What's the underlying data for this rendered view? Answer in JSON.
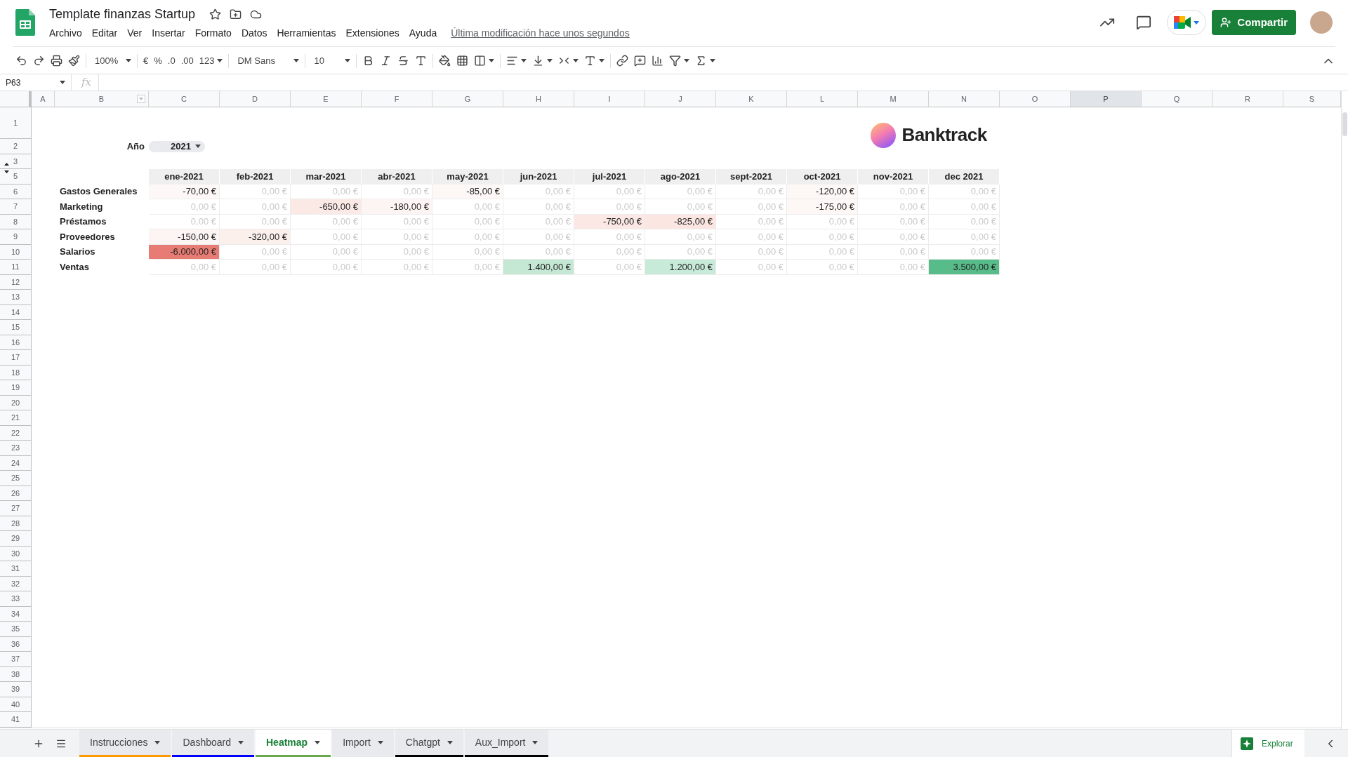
{
  "app": {
    "title": "Template finanzas Startup",
    "menu": [
      "Archivo",
      "Editar",
      "Ver",
      "Insertar",
      "Formato",
      "Datos",
      "Herramientas",
      "Extensiones",
      "Ayuda"
    ],
    "last_edit": "Última modificación hace unos segundos",
    "share_button": "Compartir"
  },
  "toolbar": {
    "zoom": "100%",
    "currency": "€",
    "percent": "%",
    "decrease_decimals": ".0",
    "increase_decimals": ".00",
    "more_formats": "123",
    "font": "DM Sans",
    "font_size": "10"
  },
  "formula_bar": {
    "cell_ref": "P63",
    "fx": "fx"
  },
  "grid": {
    "columns": [
      {
        "label": "A",
        "selected": false
      },
      {
        "label": "B",
        "selected": false
      },
      {
        "label": "C",
        "selected": false
      },
      {
        "label": "D",
        "selected": false
      },
      {
        "label": "E",
        "selected": false
      },
      {
        "label": "F",
        "selected": false
      },
      {
        "label": "G",
        "selected": false
      },
      {
        "label": "H",
        "selected": false
      },
      {
        "label": "I",
        "selected": false
      },
      {
        "label": "J",
        "selected": false
      },
      {
        "label": "K",
        "selected": false
      },
      {
        "label": "L",
        "selected": false
      },
      {
        "label": "M",
        "selected": false
      },
      {
        "label": "N",
        "selected": false
      },
      {
        "label": "O",
        "selected": false
      },
      {
        "label": "P",
        "selected": true
      },
      {
        "label": "Q",
        "selected": false
      },
      {
        "label": "R",
        "selected": false
      },
      {
        "label": "S",
        "selected": false
      }
    ],
    "rows": [
      "1",
      "2",
      "3",
      "5",
      "6",
      "7",
      "8",
      "9",
      "10",
      "11",
      "12",
      "13",
      "14",
      "15",
      "16",
      "17",
      "18",
      "19",
      "20",
      "21",
      "22",
      "23",
      "24",
      "25",
      "26",
      "27",
      "28",
      "29",
      "30",
      "31",
      "32",
      "33",
      "34",
      "35",
      "36",
      "37",
      "38",
      "39",
      "40",
      "41"
    ]
  },
  "year_selector": {
    "label": "Año",
    "value": "2021"
  },
  "logo": {
    "text": "Banktrack"
  },
  "heatmap": {
    "months": [
      "ene-2021",
      "feb-2021",
      "mar-2021",
      "abr-2021",
      "may-2021",
      "jun-2021",
      "jul-2021",
      "ago-2021",
      "sept-2021",
      "oct-2021",
      "nov-2021",
      "dec 2021"
    ],
    "rows": [
      {
        "label": "Gastos Generales",
        "cells": [
          {
            "value": "-70,00 €",
            "muted": false,
            "color": "#fdf8f7"
          },
          {
            "value": "0,00 €",
            "muted": true
          },
          {
            "value": "0,00 €",
            "muted": true
          },
          {
            "value": "0,00 €",
            "muted": true
          },
          {
            "value": "-85,00 €",
            "muted": false,
            "color": "#fdf8f6"
          },
          {
            "value": "0,00 €",
            "muted": true
          },
          {
            "value": "0,00 €",
            "muted": true
          },
          {
            "value": "0,00 €",
            "muted": true
          },
          {
            "value": "0,00 €",
            "muted": true
          },
          {
            "value": "-120,00 €",
            "muted": false,
            "color": "#fdf8f6"
          },
          {
            "value": "0,00 €",
            "muted": true
          },
          {
            "value": "0,00 €",
            "muted": true
          }
        ]
      },
      {
        "label": "Marketing",
        "cells": [
          {
            "value": "0,00 €",
            "muted": true
          },
          {
            "value": "0,00 €",
            "muted": true
          },
          {
            "value": "-650,00 €",
            "muted": false,
            "color": "#fbe9e6"
          },
          {
            "value": "-180,00 €",
            "muted": false,
            "color": "#fdf5f3"
          },
          {
            "value": "0,00 €",
            "muted": true
          },
          {
            "value": "0,00 €",
            "muted": true
          },
          {
            "value": "0,00 €",
            "muted": true
          },
          {
            "value": "0,00 €",
            "muted": true
          },
          {
            "value": "0,00 €",
            "muted": true
          },
          {
            "value": "-175,00 €",
            "muted": false,
            "color": "#fdf7f5"
          },
          {
            "value": "0,00 €",
            "muted": true
          },
          {
            "value": "0,00 €",
            "muted": true
          }
        ]
      },
      {
        "label": "Préstamos",
        "cells": [
          {
            "value": "0,00 €",
            "muted": true
          },
          {
            "value": "0,00 €",
            "muted": true
          },
          {
            "value": "0,00 €",
            "muted": true
          },
          {
            "value": "0,00 €",
            "muted": true
          },
          {
            "value": "0,00 €",
            "muted": true
          },
          {
            "value": "0,00 €",
            "muted": true
          },
          {
            "value": "-750,00 €",
            "muted": false,
            "color": "#fbe8e4"
          },
          {
            "value": "-825,00 €",
            "muted": false,
            "color": "#fbe6e2"
          },
          {
            "value": "0,00 €",
            "muted": true
          },
          {
            "value": "0,00 €",
            "muted": true
          },
          {
            "value": "0,00 €",
            "muted": true
          },
          {
            "value": "0,00 €",
            "muted": true
          }
        ]
      },
      {
        "label": "Proveedores",
        "cells": [
          {
            "value": "-150,00 €",
            "muted": false,
            "color": "#fdf5f3"
          },
          {
            "value": "-320,00 €",
            "muted": false,
            "color": "#fcf0ed"
          },
          {
            "value": "0,00 €",
            "muted": true
          },
          {
            "value": "0,00 €",
            "muted": true
          },
          {
            "value": "0,00 €",
            "muted": true
          },
          {
            "value": "0,00 €",
            "muted": true
          },
          {
            "value": "0,00 €",
            "muted": true
          },
          {
            "value": "0,00 €",
            "muted": true
          },
          {
            "value": "0,00 €",
            "muted": true
          },
          {
            "value": "0,00 €",
            "muted": true
          },
          {
            "value": "0,00 €",
            "muted": true
          },
          {
            "value": "0,00 €",
            "muted": true
          }
        ]
      },
      {
        "label": "Salarios",
        "cells": [
          {
            "value": "-6.000,00 €",
            "muted": false,
            "color": "#e67c73"
          },
          {
            "value": "0,00 €",
            "muted": true
          },
          {
            "value": "0,00 €",
            "muted": true
          },
          {
            "value": "0,00 €",
            "muted": true
          },
          {
            "value": "0,00 €",
            "muted": true
          },
          {
            "value": "0,00 €",
            "muted": true
          },
          {
            "value": "0,00 €",
            "muted": true
          },
          {
            "value": "0,00 €",
            "muted": true
          },
          {
            "value": "0,00 €",
            "muted": true
          },
          {
            "value": "0,00 €",
            "muted": true
          },
          {
            "value": "0,00 €",
            "muted": true
          },
          {
            "value": "0,00 €",
            "muted": true
          }
        ]
      },
      {
        "label": "Ventas",
        "cells": [
          {
            "value": "0,00 €",
            "muted": true
          },
          {
            "value": "0,00 €",
            "muted": true
          },
          {
            "value": "0,00 €",
            "muted": true
          },
          {
            "value": "0,00 €",
            "muted": true
          },
          {
            "value": "0,00 €",
            "muted": true
          },
          {
            "value": "1.400,00 €",
            "muted": false,
            "color": "#c5e8d4"
          },
          {
            "value": "0,00 €",
            "muted": true
          },
          {
            "value": "1.200,00 €",
            "muted": false,
            "color": "#c8eAd8"
          },
          {
            "value": "0,00 €",
            "muted": true
          },
          {
            "value": "0,00 €",
            "muted": true
          },
          {
            "value": "0,00 €",
            "muted": true
          },
          {
            "value": "3.500,00 €",
            "muted": false,
            "color": "#57bb8a"
          }
        ]
      }
    ]
  },
  "sheet_tabs": [
    {
      "label": "Instrucciones",
      "selected": false,
      "color": "#ff9900"
    },
    {
      "label": "Dashboard",
      "selected": false,
      "color": "#0000ff"
    },
    {
      "label": "Heatmap",
      "selected": true,
      "color": "#6aa84f"
    },
    {
      "label": "Import",
      "selected": false
    },
    {
      "label": "Chatgpt",
      "selected": false,
      "color": "#000000"
    },
    {
      "label": "Aux_Import",
      "selected": false,
      "color": "#000000"
    }
  ],
  "explore_button": "Explorar"
}
